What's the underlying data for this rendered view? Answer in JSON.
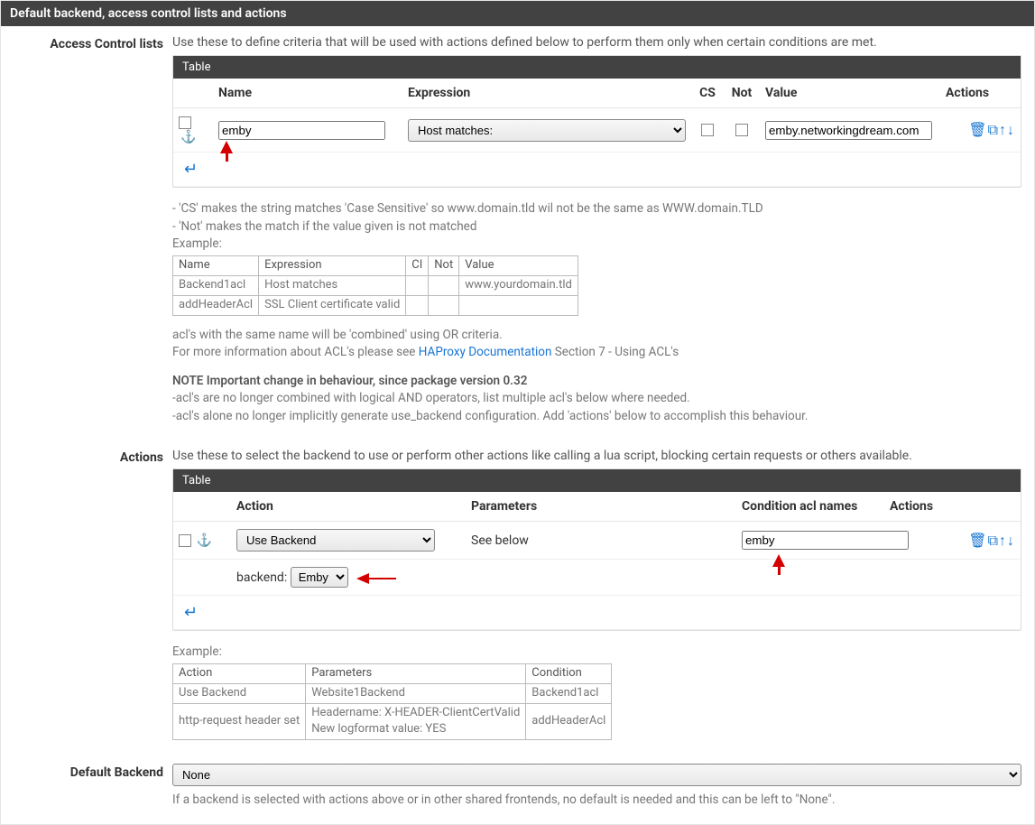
{
  "page_title": "Default backend, access control lists and actions",
  "acl": {
    "label": "Access Control lists",
    "intro": "Use these to define criteria that will be used with actions defined below to perform them only when certain conditions are met.",
    "table_title": "Table",
    "headers": {
      "name": "Name",
      "expression": "Expression",
      "cs": "CS",
      "not": "Not",
      "value": "Value",
      "actions": "Actions"
    },
    "row": {
      "name": "emby",
      "expression": "Host matches:",
      "value": "emby.networkingdream.com"
    },
    "help": {
      "line1": "- 'CS' makes the string matches 'Case Sensitive' so www.domain.tld wil not be the same as WWW.domain.TLD",
      "line2": "- 'Not' makes the match if the value given is not matched",
      "example_label": "Example:",
      "example_headers": {
        "name": "Name",
        "expression": "Expression",
        "ci": "CI",
        "not": "Not",
        "value": "Value"
      },
      "example_rows": [
        {
          "name": "Backend1acl",
          "expression": "Host matches",
          "ci": "",
          "not": "",
          "value": "www.yourdomain.tld"
        },
        {
          "name": "addHeaderAcl",
          "expression": "SSL Client certificate valid",
          "ci": "",
          "not": "",
          "value": ""
        }
      ],
      "combined": "acl's with the same name will be 'combined' using OR criteria.",
      "moreinfo_pre": "For more information about ACL's please see ",
      "moreinfo_link": "HAProxy Documentation",
      "moreinfo_post": " Section 7 - Using ACL's",
      "note_title": "NOTE Important change in behaviour, since package version 0.32",
      "note1": "-acl's are no longer combined with logical AND operators, list multiple acl's below where needed.",
      "note2": "-acl's alone no longer implicitly generate use_backend configuration. Add 'actions' below to accomplish this behaviour."
    }
  },
  "actions": {
    "label": "Actions",
    "intro": "Use these to select the backend to use or perform other actions like calling a lua script, blocking certain requests or others available.",
    "table_title": "Table",
    "headers": {
      "action": "Action",
      "parameters": "Parameters",
      "condition": "Condition acl names",
      "actions": "Actions"
    },
    "row": {
      "action": "Use Backend",
      "params_text": "See below",
      "condition": "emby",
      "backend_label": "backend:",
      "backend_value": "Emby"
    },
    "help": {
      "example_label": "Example:",
      "example_headers": {
        "action": "Action",
        "parameters": "Parameters",
        "condition": "Condition"
      },
      "example_rows": [
        {
          "action": "Use Backend",
          "parameters": "Website1Backend",
          "condition": "Backend1acl"
        },
        {
          "action": "http-request header set",
          "parameters": "Headername: X-HEADER-ClientCertValid\nNew logformat value: YES",
          "condition": "addHeaderAcl"
        }
      ]
    }
  },
  "default_backend": {
    "label": "Default Backend",
    "value": "None",
    "note": "If a backend is selected with actions above or in other shared frontends, no default is needed and this can be left to \"None\"."
  },
  "icons": {
    "trash": "🗑",
    "copy": "⧉",
    "up": "↑",
    "down": "↓",
    "anchor": "⚓",
    "return": "↵"
  }
}
